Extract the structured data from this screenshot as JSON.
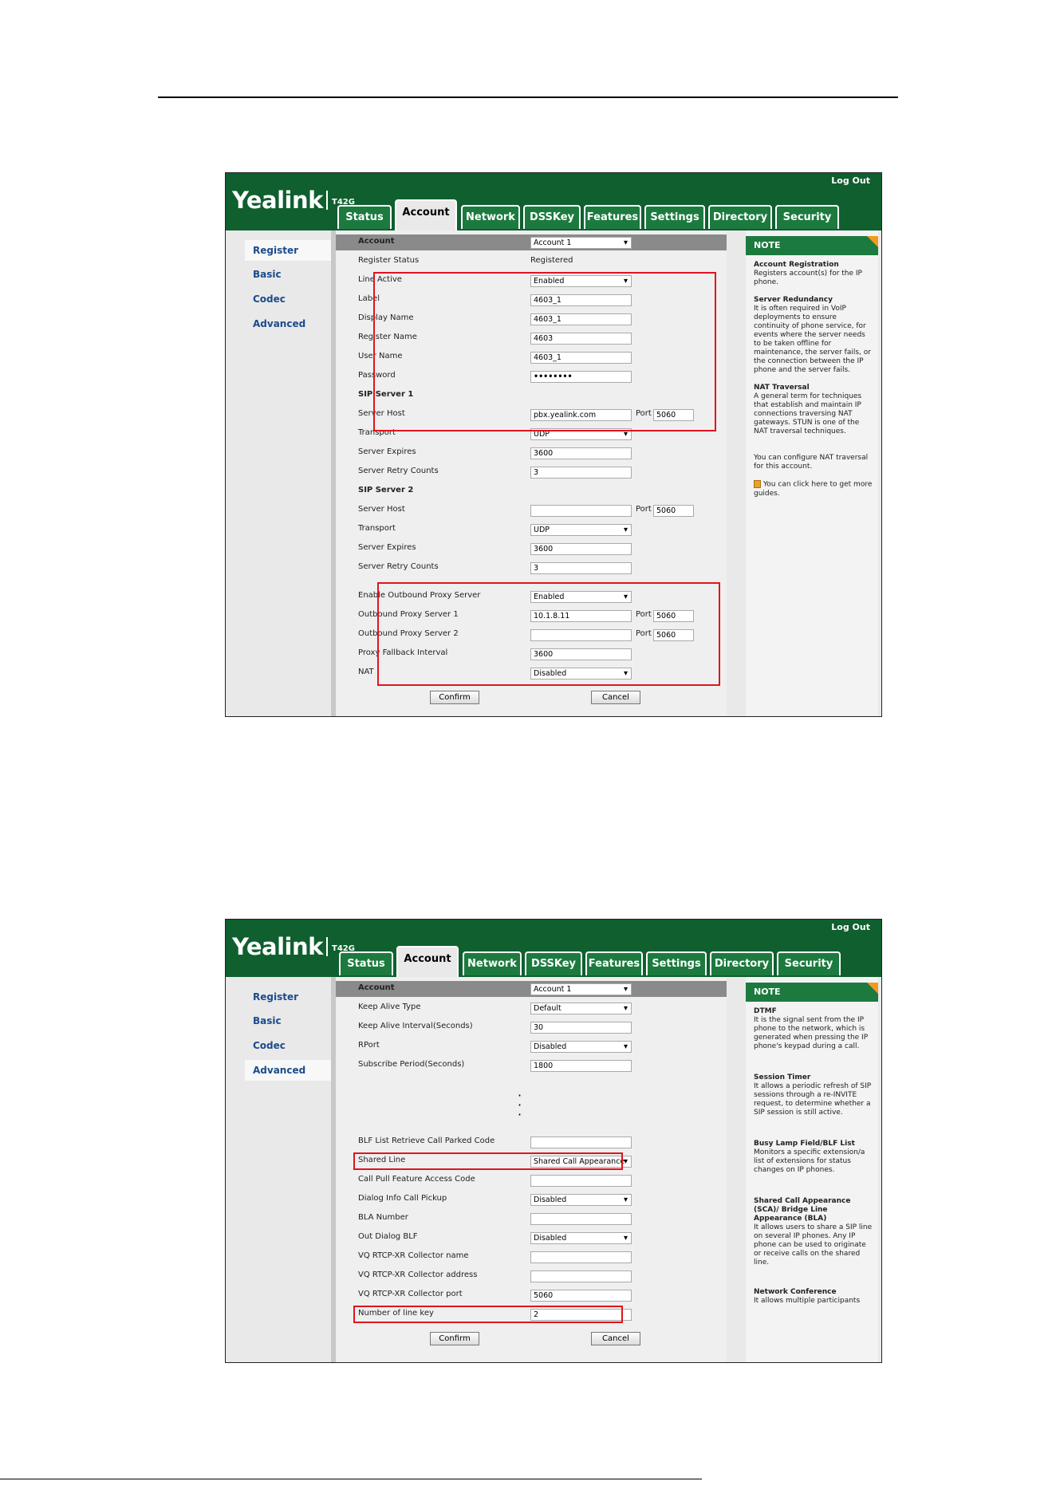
{
  "screen1": {
    "logo": "Yealink",
    "model": "T42G",
    "logout": "Log Out",
    "tabs": [
      "Status",
      "Account",
      "Network",
      "DSSKey",
      "Features",
      "Settings",
      "Directory",
      "Security"
    ],
    "nav": [
      "Register",
      "Basic",
      "Codec",
      "Advanced"
    ],
    "rows": {
      "account_label": "Account",
      "account_value": "Account 1",
      "register_status_label": "Register Status",
      "register_status_value": "Registered",
      "line_active_label": "Line Active",
      "line_active_value": "Enabled",
      "label_label": "Label",
      "label_value": "4603_1",
      "display_name_label": "Display Name",
      "display_name_value": "4603_1",
      "register_name_label": "Register Name",
      "register_name_value": "4603",
      "user_name_label": "User Name",
      "user_name_value": "4603_1",
      "password_label": "Password",
      "password_value": "••••••••",
      "sip_server1": "SIP Server 1",
      "server_host_label": "Server Host",
      "server_host_value": "pbx.yealink.com",
      "port_label": "Port",
      "port_value": "5060",
      "transport_label": "Transport",
      "transport_value": "UDP",
      "server_expires_label": "Server Expires",
      "server_expires_value": "3600",
      "retry_label": "Server Retry Counts",
      "retry_value": "3",
      "sip_server2": "SIP Server 2",
      "server_host2_label": "Server Host",
      "server_host2_value": "",
      "port2_value": "5060",
      "transport2_label": "Transport",
      "transport2_value": "UDP",
      "server_expires2_label": "Server Expires",
      "server_expires2_value": "3600",
      "retry2_label": "Server Retry Counts",
      "retry2_value": "3",
      "proxy_enable_label": "Enable Outbound Proxy Server",
      "proxy_enable_value": "Enabled",
      "proxy1_label": "Outbound Proxy Server 1",
      "proxy1_value": "10.1.8.11",
      "proxy1_port": "5060",
      "proxy2_label": "Outbound Proxy Server 2",
      "proxy2_value": "",
      "proxy2_port": "5060",
      "fallback_label": "Proxy Fallback Interval",
      "fallback_value": "3600",
      "nat_label": "NAT",
      "nat_value": "Disabled"
    },
    "confirm": "Confirm",
    "cancel": "Cancel",
    "note": {
      "head": "NOTE",
      "t1": "Account Registration",
      "p1": "Registers account(s) for the IP phone.",
      "t2": "Server Redundancy",
      "p2": "It is often required in VoIP deployments to ensure continuity of phone service, for events where the server needs to be taken offline for maintenance, the server fails, or the connection between the IP phone and the server fails.",
      "t3": "NAT Traversal",
      "p3": "A general term for techniques that establish and maintain IP connections traversing NAT gateways. STUN is one of the NAT traversal techniques.",
      "p4": "You can configure NAT traversal for this account.",
      "p5": "You can click here to get more guides."
    }
  },
  "screen2": {
    "logo": "Yealink",
    "model": "T42G",
    "logout": "Log Out",
    "tabs": [
      "Status",
      "Account",
      "Network",
      "DSSKey",
      "Features",
      "Settings",
      "Directory",
      "Security"
    ],
    "nav": [
      "Register",
      "Basic",
      "Codec",
      "Advanced"
    ],
    "rows": {
      "account_label": "Account",
      "account_value": "Account 1",
      "keep_alive_type_label": "Keep Alive Type",
      "keep_alive_type_value": "Default",
      "keep_alive_interval_label": "Keep Alive Interval(Seconds)",
      "keep_alive_interval_value": "30",
      "rport_label": "RPort",
      "rport_value": "Disabled",
      "subscribe_label": "Subscribe Period(Seconds)",
      "subscribe_value": "1800",
      "blf_parked_label": "BLF List Retrieve Call Parked Code",
      "blf_parked_value": "",
      "shared_line_label": "Shared Line",
      "shared_line_value": "Shared Call Appearance",
      "call_pull_label": "Call Pull Feature Access Code",
      "call_pull_value": "",
      "dialog_pickup_label": "Dialog Info Call Pickup",
      "dialog_pickup_value": "Disabled",
      "bla_label": "BLA Number",
      "bla_value": "",
      "out_dialog_label": "Out Dialog BLF",
      "out_dialog_value": "Disabled",
      "vq_name_label": "VQ RTCP-XR Collector name",
      "vq_name_value": "",
      "vq_addr_label": "VQ RTCP-XR Collector address",
      "vq_addr_value": "",
      "vq_port_label": "VQ RTCP-XR Collector port",
      "vq_port_value": "5060",
      "linekey_label": "Number of line key",
      "linekey_value": "2"
    },
    "confirm": "Confirm",
    "cancel": "Cancel",
    "note": {
      "head": "NOTE",
      "t1": "DTMF",
      "p1": "It is the signal sent from the IP phone to the network, which is generated when pressing the IP phone's keypad during a call.",
      "t2": "Session Timer",
      "p2": "It allows a periodic refresh of SIP sessions through a re-INVITE request, to determine whether a SIP session is still active.",
      "t3": "Busy Lamp Field/BLF List",
      "p3": "Monitors a specific extension/a list of extensions for status changes on IP phones.",
      "t4": "Shared Call Appearance (SCA)/ Bridge Line Appearance (BLA)",
      "p4": "It allows users to share a SIP line on several IP phones. Any IP phone can be used to originate or receive calls on the shared line.",
      "t5": "Network Conference",
      "p5": "It allows multiple participants"
    }
  }
}
